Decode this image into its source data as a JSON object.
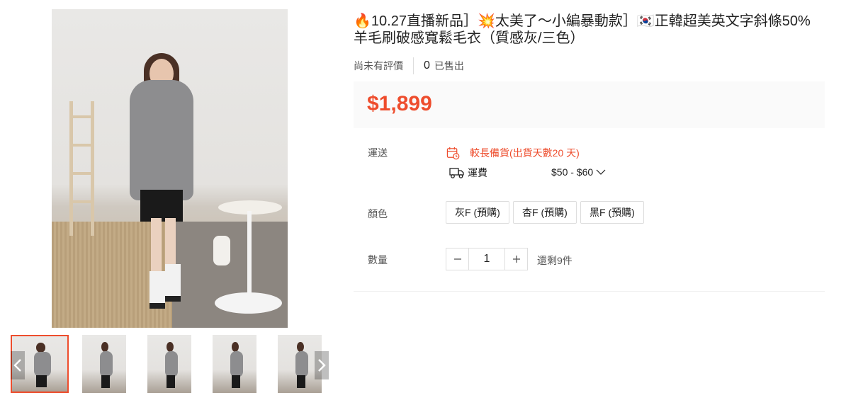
{
  "product": {
    "title": "🔥10.27直播新品］💥太美了～小編暴動款］🇰🇷正韓超美英文字斜條50%羊毛刷破感寬鬆毛衣（質感灰/三色）",
    "rating_text": "尚未有評價",
    "sold_count": "0",
    "sold_label": "已售出",
    "price": "$1,899"
  },
  "gallery": {
    "main_image_icon": "product-photo",
    "thumbnail_count": 5,
    "active_thumbnail_index": 0,
    "prev_icon": "chevron-left-icon",
    "next_icon": "chevron-right-icon"
  },
  "shipping": {
    "label": "運送",
    "note": "較長備貨(出貨天數20 天)",
    "fee_label": "運費",
    "fee_range": "$50 - $60"
  },
  "variations": {
    "label": "顏色",
    "options": [
      "灰F (預購)",
      "杏F (預購)",
      "黑F (預購)"
    ]
  },
  "quantity": {
    "label": "數量",
    "value": "1",
    "stock_text": "還剩9件"
  },
  "colors": {
    "accent": "#ee4d2d",
    "price_bg": "#fafafa",
    "border": "#dddddd"
  }
}
